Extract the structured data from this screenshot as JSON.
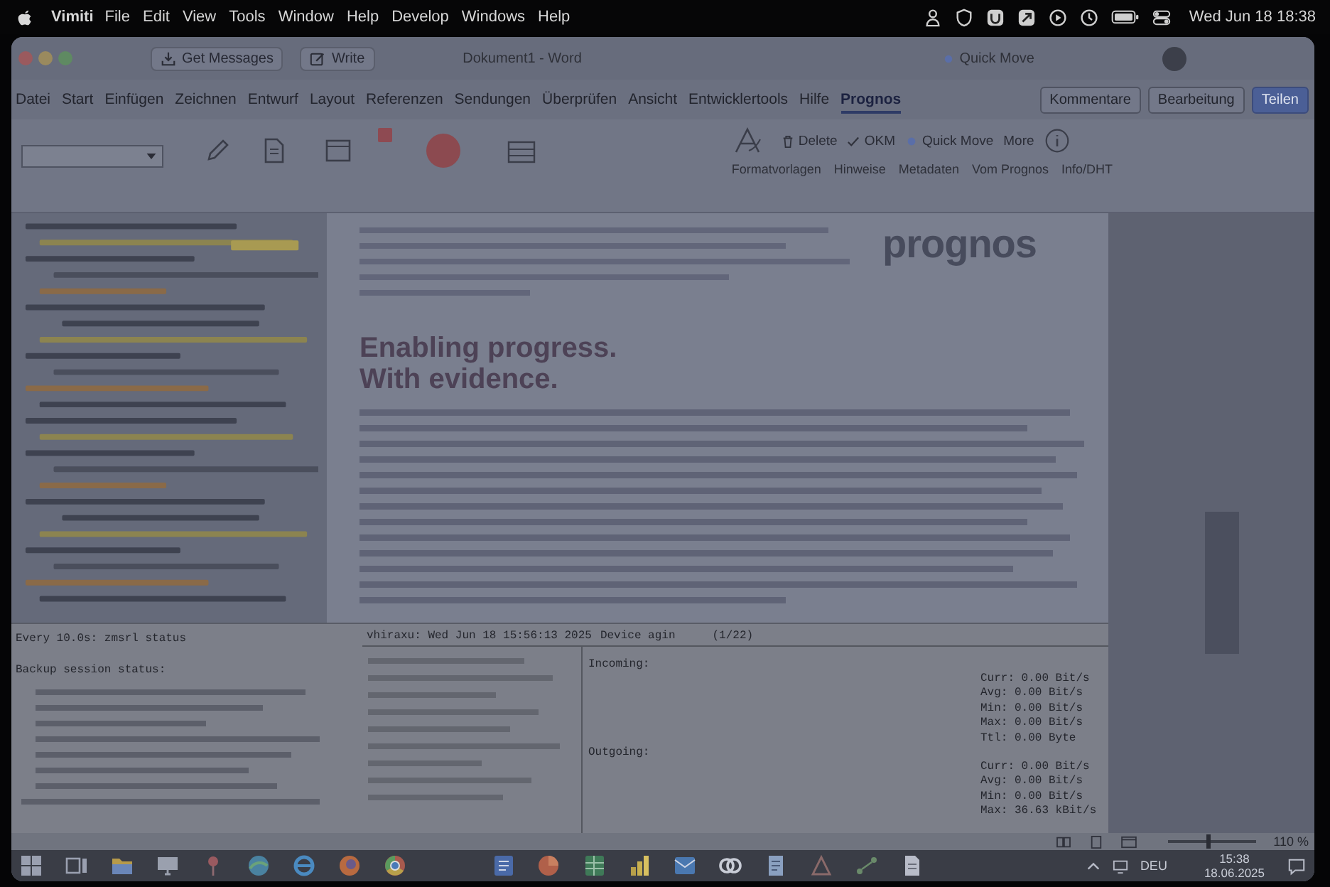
{
  "menu_bar": {
    "app_name": "Vimiti",
    "menus": [
      "File",
      "Edit",
      "View",
      "Tools",
      "Window",
      "Help",
      "Develop",
      "Windows",
      "Help"
    ],
    "clock": "Wed Jun 18 18:38"
  },
  "title_bar": {
    "buttons": [
      "Get Messages",
      "Write"
    ],
    "document_title": "Dokument1 - Word",
    "quick_move": "Quick Move"
  },
  "ribbon": {
    "tabs": [
      {
        "label": "Datei",
        "selected": false
      },
      {
        "label": "Start",
        "selected": false
      },
      {
        "label": "Einfügen",
        "selected": false
      },
      {
        "label": "Zeichnen",
        "selected": false
      },
      {
        "label": "Entwurf",
        "selected": false
      },
      {
        "label": "Layout",
        "selected": false
      },
      {
        "label": "Referenzen",
        "selected": false
      },
      {
        "label": "Sendungen",
        "selected": false
      },
      {
        "label": "Überprüfen",
        "selected": false
      },
      {
        "label": "Ansicht",
        "selected": false
      },
      {
        "label": "Entwicklertools",
        "selected": false
      },
      {
        "label": "Hilfe",
        "selected": false
      },
      {
        "label": "Prognos",
        "selected": true
      }
    ],
    "actions": [
      {
        "label": "Kommentare",
        "kind": "outline"
      },
      {
        "label": "Bearbeitung",
        "kind": "outline"
      },
      {
        "label": "Teilen",
        "kind": "primary"
      }
    ],
    "commands": [
      "Delete",
      "OKM",
      "Quick Move",
      "More"
    ],
    "groups": [
      "Formatvorlagen",
      "Hinweise",
      "Metadaten",
      "Vom Prognos",
      "Info/DHT"
    ]
  },
  "document": {
    "logo": "prognos",
    "heading": "Enabling progress.",
    "subheading": "With evidence."
  },
  "watch_terminal": {
    "header": "Every 10.0s: zmsrl status",
    "title": "Backup session status:"
  },
  "traffic_monitor": {
    "header": "vhiraxu: Wed Jun 18 15:56:13 2025",
    "device": "Device agin",
    "page": "(1/22)",
    "sections": [
      {
        "label": "Incoming:",
        "stats": [
          "Curr: 0.00 Bit/s",
          "Avg: 0.00 Bit/s",
          "Min: 0.00 Bit/s",
          "Max: 0.00 Bit/s",
          "Ttl: 0.00 Byte"
        ]
      },
      {
        "label": "Outgoing:",
        "stats": [
          "Curr: 0.00 Bit/s",
          "Avg: 0.00 Bit/s",
          "Min: 0.00 Bit/s",
          "Max: 36.63 kBit/s"
        ]
      }
    ]
  },
  "status_bar": {
    "zoom": "110 %",
    "zoom_slider": {
      "level": 0.45
    }
  },
  "taskbar": {
    "language": "DEU",
    "time": "15:38",
    "date": "18.06.2025"
  }
}
